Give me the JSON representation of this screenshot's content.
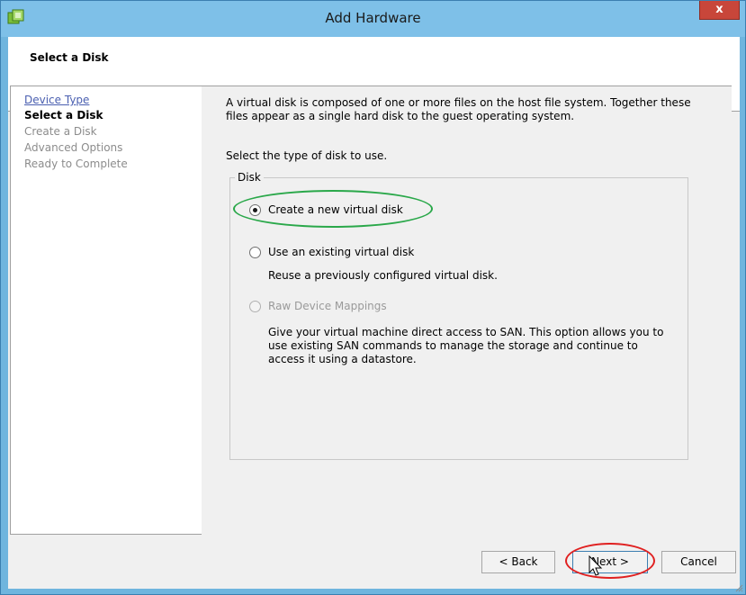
{
  "window": {
    "title": "Add Hardware",
    "close_label": "x",
    "accent_color": "#7ec0e8"
  },
  "header": {
    "title": "Select a Disk"
  },
  "steps": [
    {
      "label": "Device Type",
      "state": "link"
    },
    {
      "label": "Select a Disk",
      "state": "current"
    },
    {
      "label": "Create a Disk",
      "state": "pending"
    },
    {
      "label": "Advanced Options",
      "state": "pending"
    },
    {
      "label": "Ready to Complete",
      "state": "pending"
    }
  ],
  "content": {
    "intro_line1": "A virtual disk is composed of one or more files on the host file system. Together these",
    "intro_line2": "files appear as a single hard disk to the guest operating system.",
    "select_prompt": "Select the type of disk to use.",
    "group_label": "Disk",
    "options": [
      {
        "label": "Create a new virtual disk",
        "checked": true,
        "enabled": true
      },
      {
        "label": "Use an existing virtual disk",
        "checked": false,
        "enabled": true,
        "description": "Reuse a previously configured virtual disk."
      },
      {
        "label": "Raw Device Mappings",
        "checked": false,
        "enabled": false,
        "description_lines": [
          "Give your virtual machine direct access to SAN. This option allows you to",
          "use existing SAN commands to manage the storage and continue to",
          "access it using a datastore."
        ]
      }
    ]
  },
  "buttons": {
    "back": "< Back",
    "next": "Next >",
    "cancel": "Cancel"
  },
  "icons": {
    "app": "vsphere-app-icon",
    "cursor": "mouse-pointer-icon"
  }
}
